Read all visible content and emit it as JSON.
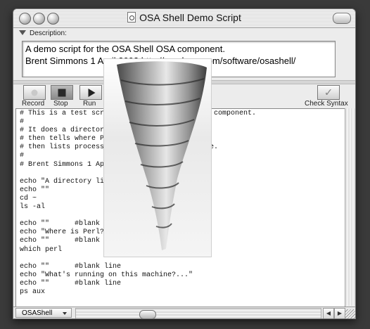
{
  "window": {
    "title": "OSA Shell Demo Script"
  },
  "description": {
    "label": "Description:",
    "text_lines": [
      "A demo script for the OSA Shell OSA component.",
      "Brent Simmons 1 April 2002 http://ranchero.com/software/osashell/"
    ]
  },
  "toolbar": {
    "record_label": "Record",
    "stop_label": "Stop",
    "run_label": "Run",
    "check_syntax_label": "Check Syntax"
  },
  "script": {
    "text": "# This is a test script for the OSA Shell OSA component.\n#\n# It does a directory listing,\n# then tells where Perl is,\n# then lists processes running on this machine.\n#\n# Brent Simmons 1 April 2002\n\necho \"A directory listing...\"\necho \"\"\ncd ~\nls -al\n\necho \"\"      #blank line\necho \"Where is Perl?\"\necho \"\"      #blank line\nwhich perl\n\necho \"\"      #blank line\necho \"What's running on this machine?...\"\necho \"\"      #blank line\nps aux"
  },
  "bottom": {
    "language_popup_value": "OSAShell"
  },
  "icons": {
    "window_controls": [
      "close-icon",
      "minimize-icon",
      "zoom-icon"
    ],
    "toolbar": [
      "record-icon",
      "stop-icon",
      "run-icon",
      "check-syntax-icon"
    ]
  },
  "colors": {
    "desktop": "#3a3a3a",
    "window_bg": "#ececec",
    "editor_bg": "#ffffff"
  },
  "overlay_image": {
    "subject": "tornado"
  }
}
